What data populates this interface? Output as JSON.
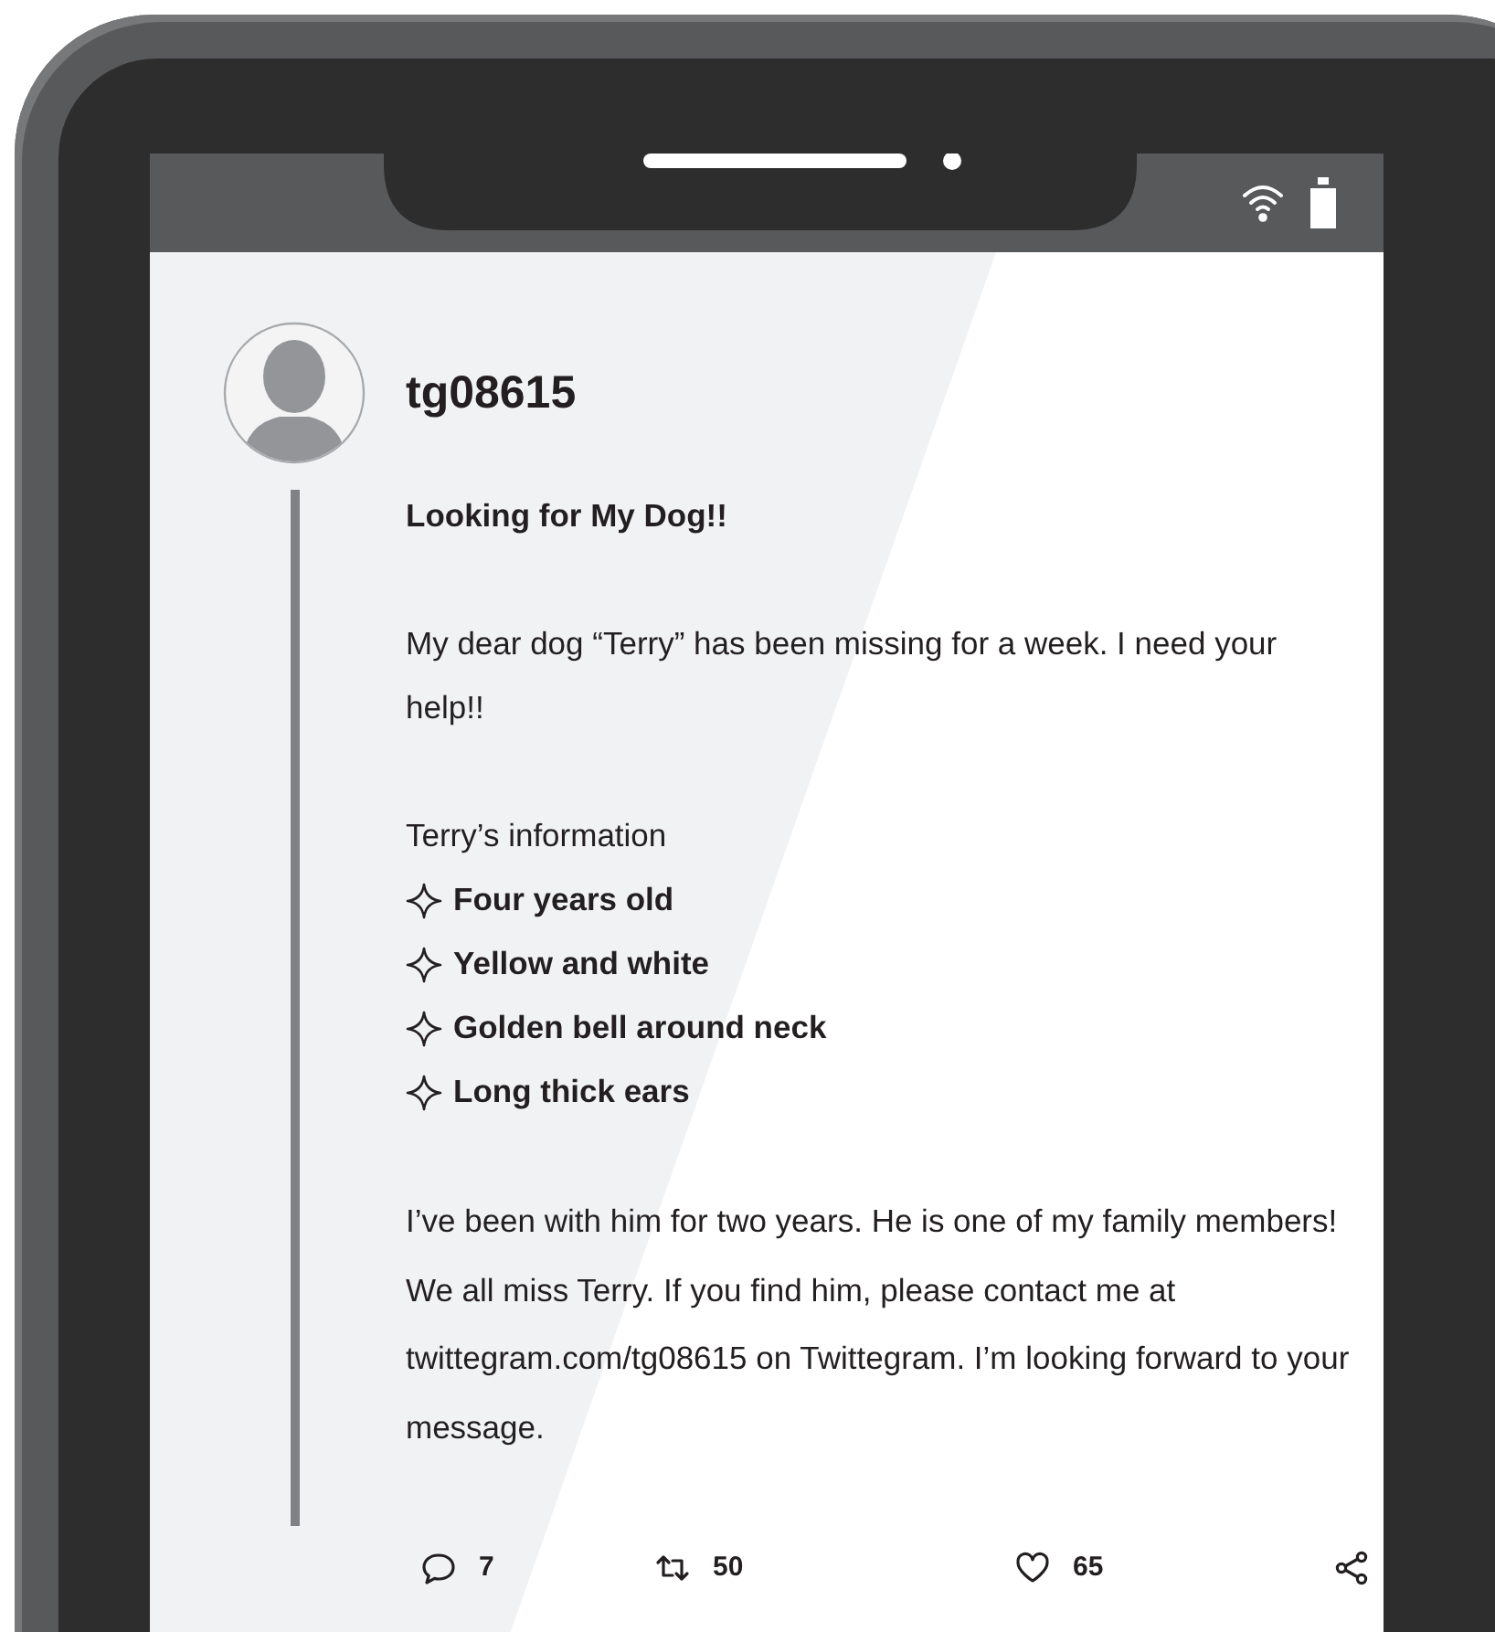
{
  "post": {
    "username": "tg08615",
    "title": "Looking for My Dog!!",
    "intro": "My dear dog “Terry” has been missing for a week. I need your help!!",
    "info_heading": "Terry’s information",
    "info_items": [
      "Four years old",
      "Yellow and white",
      "Golden bell around neck",
      "Long thick ears"
    ],
    "closing": "I’ve been with him for two years. He is one of my family members! We all miss Terry. If you find him, please contact me at twittegram.com/tg08615 on Twittegram. I’m looking forward to your message.",
    "actions": [
      {
        "kind": "reply",
        "count": "7"
      },
      {
        "kind": "repost",
        "count": "50"
      },
      {
        "kind": "like",
        "count": "65"
      },
      {
        "kind": "share"
      }
    ]
  }
}
